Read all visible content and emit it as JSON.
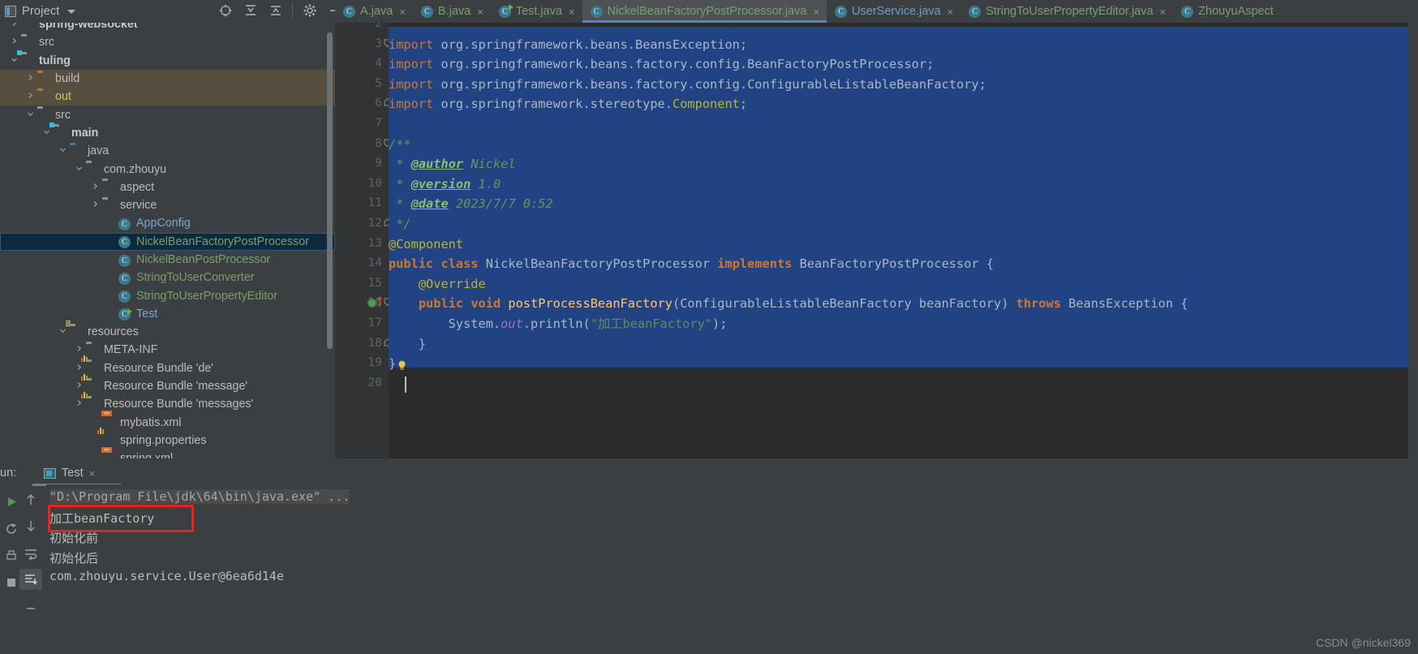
{
  "topbar": {
    "project_label": "Project",
    "dropdown_icon": "chevron-down-icon",
    "icons": [
      "locate-icon",
      "expand-all-icon",
      "collapse-all-icon",
      "gear-icon",
      "minimize-icon"
    ]
  },
  "tabs": [
    {
      "label": "A.java",
      "icon": "class-icon",
      "color": "green",
      "active": false,
      "runnable": false,
      "close": "×"
    },
    {
      "label": "B.java",
      "icon": "class-icon",
      "color": "green",
      "active": false,
      "runnable": false,
      "close": "×"
    },
    {
      "label": "Test.java",
      "icon": "class-icon",
      "color": "green",
      "active": false,
      "runnable": true,
      "close": "×"
    },
    {
      "label": "NickelBeanFactoryPostProcessor.java",
      "icon": "class-icon",
      "color": "green",
      "active": true,
      "runnable": false,
      "close": "×"
    },
    {
      "label": "UserService.java",
      "icon": "class-icon",
      "color": "blue",
      "active": false,
      "runnable": false,
      "close": "×"
    },
    {
      "label": "StringToUserPropertyEditor.java",
      "icon": "class-icon",
      "color": "green",
      "active": false,
      "runnable": false,
      "close": "×"
    },
    {
      "label": "ZhouyuAspect",
      "icon": "class-icon",
      "color": "green",
      "active": false,
      "runnable": false,
      "close": ""
    }
  ],
  "tree": [
    {
      "label": "spring-websocket",
      "indent": 0,
      "arrow": "›",
      "icon": "module-folder-icon",
      "style": "bold",
      "state": "clipped"
    },
    {
      "label": "src",
      "indent": 0,
      "arrow": "›",
      "icon": "folder-icon",
      "style": "normal",
      "state": ""
    },
    {
      "label": "tuling",
      "indent": 0,
      "arrow": "⌄",
      "icon": "module-folder-icon",
      "style": "bold",
      "state": ""
    },
    {
      "label": "build",
      "indent": 1,
      "arrow": "›",
      "icon": "excluded-folder-icon",
      "style": "normal",
      "state": "excluded"
    },
    {
      "label": "out",
      "indent": 1,
      "arrow": "›",
      "icon": "excluded-folder-icon",
      "style": "yellow",
      "state": "excluded"
    },
    {
      "label": "src",
      "indent": 1,
      "arrow": "⌄",
      "icon": "folder-icon",
      "style": "normal",
      "state": ""
    },
    {
      "label": "main",
      "indent": 2,
      "arrow": "⌄",
      "icon": "source-folder-icon",
      "style": "bold",
      "state": ""
    },
    {
      "label": "java",
      "indent": 3,
      "arrow": "⌄",
      "icon": "source-root-icon",
      "style": "normal",
      "state": ""
    },
    {
      "label": "com.zhouyu",
      "indent": 4,
      "arrow": "⌄",
      "icon": "package-icon",
      "style": "normal",
      "state": ""
    },
    {
      "label": "aspect",
      "indent": 5,
      "arrow": "›",
      "icon": "package-icon",
      "style": "normal",
      "state": ""
    },
    {
      "label": "service",
      "indent": 5,
      "arrow": "›",
      "icon": "package-icon",
      "style": "normal",
      "state": ""
    },
    {
      "label": "AppConfig",
      "indent": 6,
      "arrow": "",
      "icon": "class-icon",
      "style": "blue",
      "state": ""
    },
    {
      "label": "NickelBeanFactoryPostProcessor",
      "indent": 6,
      "arrow": "",
      "icon": "class-icon",
      "style": "green",
      "state": "selected"
    },
    {
      "label": "NickelBeanPostProcessor",
      "indent": 6,
      "arrow": "",
      "icon": "class-icon",
      "style": "green",
      "state": ""
    },
    {
      "label": "StringToUserConverter",
      "indent": 6,
      "arrow": "",
      "icon": "class-icon",
      "style": "green",
      "state": ""
    },
    {
      "label": "StringToUserPropertyEditor",
      "indent": 6,
      "arrow": "",
      "icon": "class-icon",
      "style": "green",
      "state": ""
    },
    {
      "label": "Test",
      "indent": 6,
      "arrow": "",
      "icon": "runnable-class-icon",
      "style": "blue",
      "state": ""
    },
    {
      "label": "resources",
      "indent": 3,
      "arrow": "⌄",
      "icon": "resource-folder-icon",
      "style": "normal",
      "state": ""
    },
    {
      "label": "META-INF",
      "indent": 4,
      "arrow": "›",
      "icon": "folder-icon",
      "style": "normal",
      "state": ""
    },
    {
      "label": "Resource Bundle 'de'",
      "indent": 4,
      "arrow": "›",
      "icon": "resource-bundle-icon",
      "style": "normal",
      "state": ""
    },
    {
      "label": "Resource Bundle 'message'",
      "indent": 4,
      "arrow": "›",
      "icon": "resource-bundle-icon",
      "style": "normal",
      "state": ""
    },
    {
      "label": "Resource Bundle 'messages'",
      "indent": 4,
      "arrow": "›",
      "icon": "resource-bundle-icon",
      "style": "normal",
      "state": ""
    },
    {
      "label": "mybatis.xml",
      "indent": 5,
      "arrow": "",
      "icon": "xml-file-icon",
      "style": "normal",
      "state": ""
    },
    {
      "label": "spring.properties",
      "indent": 5,
      "arrow": "",
      "icon": "properties-file-icon",
      "style": "normal",
      "state": ""
    },
    {
      "label": "spring.xml",
      "indent": 5,
      "arrow": "",
      "icon": "xml-file-icon",
      "style": "normal",
      "state": "clipped-bottom"
    }
  ],
  "editor": {
    "first_line": 2,
    "last_line": 20,
    "lines": [
      {
        "n": 2,
        "text": ""
      },
      {
        "n": 3,
        "text": "import org.springframework.beans.BeansException;"
      },
      {
        "n": 4,
        "text": "import org.springframework.beans.factory.config.BeanFactoryPostProcessor;"
      },
      {
        "n": 5,
        "text": "import org.springframework.beans.factory.config.ConfigurableListableBeanFactory;"
      },
      {
        "n": 6,
        "text": "import org.springframework.stereotype.Component;"
      },
      {
        "n": 7,
        "text": ""
      },
      {
        "n": 8,
        "text": "/**"
      },
      {
        "n": 9,
        "text": " * @author Nickel"
      },
      {
        "n": 10,
        "text": " * @version 1.0"
      },
      {
        "n": 11,
        "text": " * @date 2023/7/7 0:52"
      },
      {
        "n": 12,
        "text": " */"
      },
      {
        "n": 13,
        "text": "@Component"
      },
      {
        "n": 14,
        "text": "public class NickelBeanFactoryPostProcessor implements BeanFactoryPostProcessor {"
      },
      {
        "n": 15,
        "text": "    @Override"
      },
      {
        "n": 16,
        "text": "    public void postProcessBeanFactory(ConfigurableListableBeanFactory beanFactory) throws BeansException {"
      },
      {
        "n": 17,
        "text": "        System.out.println(\"加工beanFactory\");"
      },
      {
        "n": 18,
        "text": "    }"
      },
      {
        "n": 19,
        "text": "}"
      },
      {
        "n": 20,
        "text": ""
      }
    ],
    "gutter_run_line": 16,
    "bulb_line": 19,
    "caret_line": 20
  },
  "run_panel": {
    "run_label": "un:",
    "tab_name": "Test",
    "tab_close": "×",
    "sidebar_icons": [
      "rerun-icon",
      "scroll-up-icon",
      "scroll-down-icon",
      "rerun-failed-icon",
      "soft-wrap-icon",
      "scroll-to-end-icon",
      "print-icon",
      "stop-icon"
    ],
    "console_lines": [
      {
        "text": "\"D:\\Program File\\jdk\\64\\bin\\java.exe\" ...",
        "dim": true
      },
      {
        "text": "加工beanFactory",
        "dim": false,
        "highlighted": true
      },
      {
        "text": "初始化前",
        "dim": false
      },
      {
        "text": "初始化后",
        "dim": false
      },
      {
        "text": "com.zhouyu.service.User@6ea6d14e",
        "dim": false
      }
    ],
    "highlight_color": "#f21d1d"
  },
  "watermark": "CSDN @nickel369"
}
